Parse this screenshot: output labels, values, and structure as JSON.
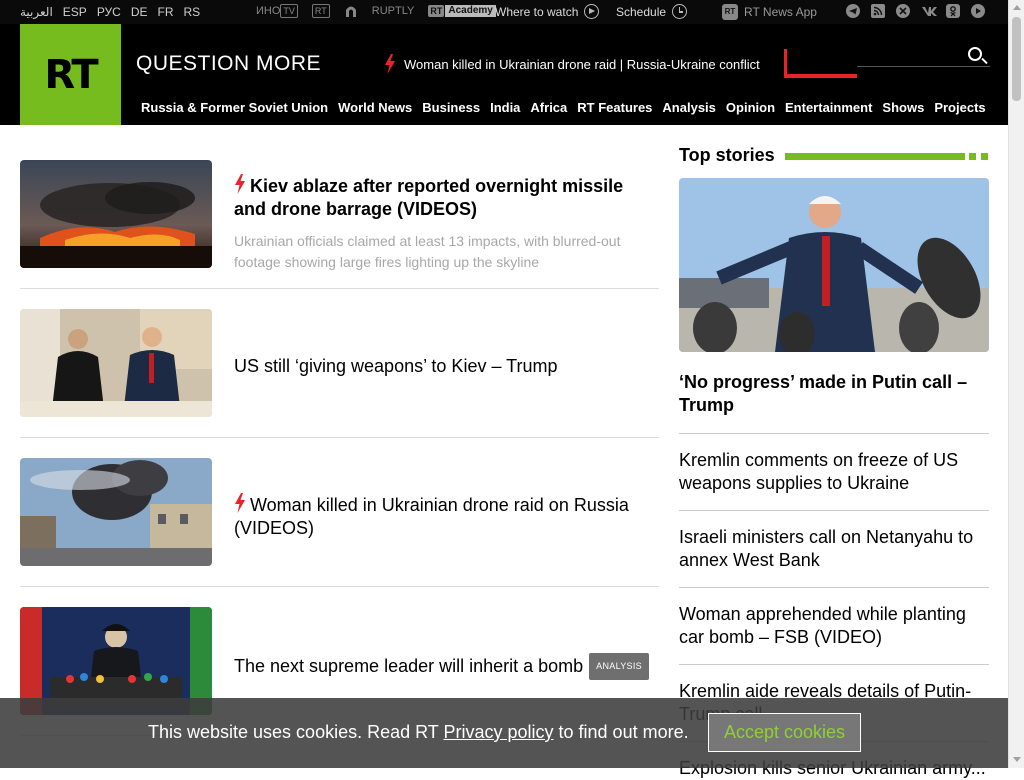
{
  "topbar": {
    "languages": [
      "العربية",
      "ESP",
      "РУС",
      "DE",
      "FR",
      "RS"
    ],
    "brands": {
      "inotv": "ИНО",
      "inotv_box": "TV",
      "rtd": "RT",
      "ruptly": "RUPTLY",
      "academy": "Academy"
    },
    "where_to_watch": "Where to watch",
    "schedule": "Schedule",
    "news_app_icon": "RT",
    "news_app": "RT News App",
    "social_icons": [
      "telegram-icon",
      "rss-icon",
      "x-icon",
      "vk-icon",
      "odnoklassniki-icon",
      "rumble-icon"
    ]
  },
  "header": {
    "logo": "RT",
    "slogan": "QUESTION MORE",
    "breaking": "Woman killed in Ukrainian drone raid | Russia-Ukraine conflict",
    "nav": [
      "Russia & Former Soviet Union",
      "World News",
      "Business",
      "India",
      "Africa",
      "RT Features",
      "Analysis",
      "Opinion",
      "Entertainment",
      "Shows",
      "Projects"
    ]
  },
  "articles": [
    {
      "title": "Kiev ablaze after reported overnight missile and drone barrage (VIDEOS)",
      "desc": "Ukrainian officials claimed at least 13 impacts, with blurred-out footage showing large fires lighting up the skyline"
    },
    {
      "title": "US still ‘giving weapons’ to Kiev – Trump"
    },
    {
      "title": "Woman killed in Ukrainian drone raid on Russia (VIDEOS)"
    },
    {
      "title": "The next supreme leader will inherit a bomb",
      "badge": "ANALYSIS"
    }
  ],
  "sidebar": {
    "heading": "Top stories",
    "lead": "‘No progress’ made in Putin call – Trump",
    "items": [
      "Kremlin comments on freeze of US weapons supplies to Ukraine",
      "Israeli ministers call on Netanyahu to annex West Bank",
      "Woman apprehended while planting car bomb – FSB (VIDEO)",
      "Kremlin aide reveals details of Putin-Trump call",
      "Explosion kills senior Ukrainian army..."
    ]
  },
  "cookie": {
    "pre": "This website uses cookies. Read RT ",
    "link": "Privacy policy",
    "post": " to find out more.",
    "button": "Accept cookies"
  },
  "colors": {
    "brand_green": "#77bc1f",
    "accent_red": "#e8232a"
  }
}
